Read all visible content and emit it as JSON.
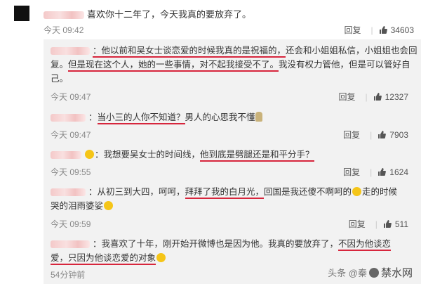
{
  "top_comment": {
    "text": "喜欢你十二年了，今天我真的要放弃了。",
    "time": "今天 09:42",
    "reply_label": "回复",
    "likes": "34603"
  },
  "replies": [
    {
      "seg1": "：他以前和吴女士谈恋爱的时候我真的是祝福的，",
      "seg2": "还会和小姐姐私信，小姐姐也会回",
      "seg3": "复。",
      "seg4": "但是现在这个人，她的一些事情，对不起我接受不了。",
      "seg5": "我没有权力管他，但是可以管好自",
      "seg6": "己。",
      "time": "今天 09:47",
      "reply_label": "回复",
      "likes": "12327"
    },
    {
      "seg1": "：",
      "seg2": "当小三的人你不知道？",
      "seg3": "男人的心思我不懂",
      "time": "今天 09:47",
      "reply_label": "回复",
      "likes": "7903"
    },
    {
      "seg1": "：我想要吴女士的时间线，",
      "seg2": "他到底是劈腿还是和平分手？",
      "time": "今天 09:55",
      "reply_label": "回复",
      "likes": "1624"
    },
    {
      "seg1": "：从初三到大四，呵呵，",
      "seg2": "拜拜了我的白月光，",
      "seg3": "回国是我还傻不啊呵的",
      "seg4": "走的时候",
      "seg5": "哭的泪雨婆娑",
      "time": "今天 09:59",
      "reply_label": "回复",
      "likes": "511"
    },
    {
      "seg1": "：我喜欢了十年，刚开始开微博也是因为他。我真的要放弃了，",
      "seg2": "不因为他谈恋",
      "seg3": "爱，只因为他谈恋爱的对象",
      "time": "54分钟前"
    }
  ],
  "watermark": {
    "prefix": "头条",
    "at": "@",
    "name": "秦",
    "logo_text": "禁水网"
  },
  "colors": {
    "underline": "#d7263d",
    "reply_bg": "#f2f2f2"
  },
  "icons": [
    "avatar",
    "thumbs-up-icon",
    "emoji-icon"
  ]
}
